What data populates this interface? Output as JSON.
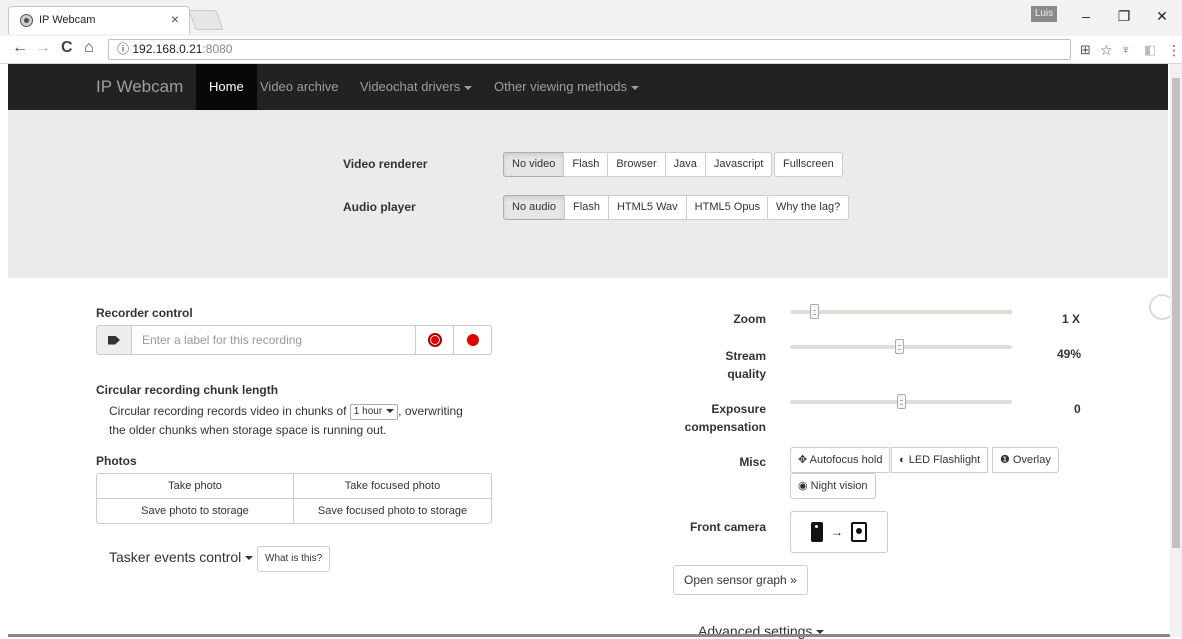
{
  "browser": {
    "tab_title": "IP Webcam",
    "tab_close": "×",
    "profile_name": "Luis",
    "url_host": "192.168.0.21",
    "url_port": ":8080",
    "url_info_icon": "ⓘ",
    "minimize": "–",
    "restore": "❐",
    "close": "✕",
    "back": "←",
    "forward": "→",
    "reload": "C",
    "home": "⌂",
    "star": "☆",
    "menu": "⋮"
  },
  "nav": {
    "brand": "IP Webcam",
    "home": "Home",
    "video_archive": "Video archive",
    "videochat_drivers": "Videochat drivers",
    "other_viewing": "Other viewing methods"
  },
  "renderer": {
    "video_label": "Video renderer",
    "video_options": [
      "No video",
      "Flash",
      "Browser",
      "Java",
      "Javascript"
    ],
    "video_selected": "No video",
    "fullscreen": "Fullscreen",
    "audio_label": "Audio player",
    "audio_options": [
      "No audio",
      "Flash",
      "HTML5 Wav",
      "HTML5 Opus"
    ],
    "audio_selected": "No audio",
    "why_lag": "Why the lag?"
  },
  "recorder": {
    "title": "Recorder control",
    "placeholder": "Enter a label for this recording"
  },
  "circular": {
    "title": "Circular recording chunk length",
    "text_before": "Circular recording records video in chunks of",
    "chunk_value": "1 hour",
    "text_after": ", overwriting",
    "text_line2": "the older chunks when storage space is running out."
  },
  "photos": {
    "title": "Photos",
    "take_photo": "Take photo",
    "take_focused": "Take focused photo",
    "save_photo": "Save photo to storage",
    "save_focused": "Save focused photo to storage"
  },
  "tasker": {
    "label": "Tasker events control",
    "what": "What is this?"
  },
  "controls": {
    "zoom_label": "Zoom",
    "zoom_value": "1 X",
    "zoom_level": 0.03,
    "quality_label_1": "Stream",
    "quality_label_2": "quality",
    "quality_value": "49%",
    "quality_level": 0.49,
    "exposure_label_1": "Exposure",
    "exposure_label_2": "compensation",
    "exposure_value": "0",
    "exposure_level": 0.5,
    "misc_label": "Misc",
    "autofocus": "Autofocus hold",
    "led": "LED Flashlight",
    "overlay": "Overlay",
    "night": "Night vision",
    "front_camera_label": "Front camera",
    "sensor_graph": "Open sensor graph »",
    "advanced": "Advanced settings"
  }
}
